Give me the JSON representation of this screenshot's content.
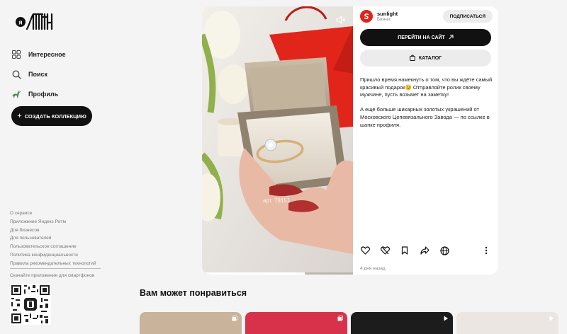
{
  "app": {
    "logo_text": "яритм"
  },
  "sidebar": {
    "nav": [
      {
        "label": "Интересное",
        "icon": "grid-icon"
      },
      {
        "label": "Поиск",
        "icon": "search-icon"
      },
      {
        "label": "Профиль",
        "icon": "profile-dino-icon"
      }
    ],
    "create_label": "СОЗДАТЬ КОЛЛЕКЦИЮ",
    "footer_links": [
      "О сервисе",
      "Приложение Яндекс Ритм",
      "Для бизнесов",
      "Для пользователей",
      "Пользовательское соглашение",
      "Политика конфиденциальности",
      "Правила рекомендательных технологий"
    ],
    "app_promo": "Скачайте приложение для смартфонов"
  },
  "post": {
    "media": {
      "overlay_text": "арт. 79151",
      "progress": 0.68,
      "mute_icon": "speaker-muted-icon"
    },
    "author": {
      "name": "sunlight",
      "subtitle": "Бизнес",
      "avatar_color": "#e2231a"
    },
    "subscribe_label": "ПОДПИСАТЬСЯ",
    "go_site_label": "ПЕРЕЙТИ НА САЙТ",
    "catalog_label": "КАТАЛОГ",
    "description": [
      "Пришло время намекнуть о том, что вы ждёте самый красивый подарок😉 Отправляйте ролик своему мужчине, пусть возьмет на заметку!",
      "А ещё больше шикарных золотых украшений от Московского Цепевязального Завода — по ссылке в шапке профиля."
    ],
    "actions": [
      "heart-icon",
      "broken-heart-icon",
      "bookmark-icon",
      "share-icon",
      "globe-icon"
    ],
    "date": "4 дня назад"
  },
  "recommendations": {
    "title": "Вам может понравиться",
    "tiles": [
      {
        "color": "#c9b39a"
      },
      {
        "color": "#d8324a"
      },
      {
        "color": "#1c1c1c"
      },
      {
        "color": "#ece6e2"
      }
    ]
  },
  "colors": {
    "accent": "#111111",
    "brand_red": "#e2231a"
  }
}
